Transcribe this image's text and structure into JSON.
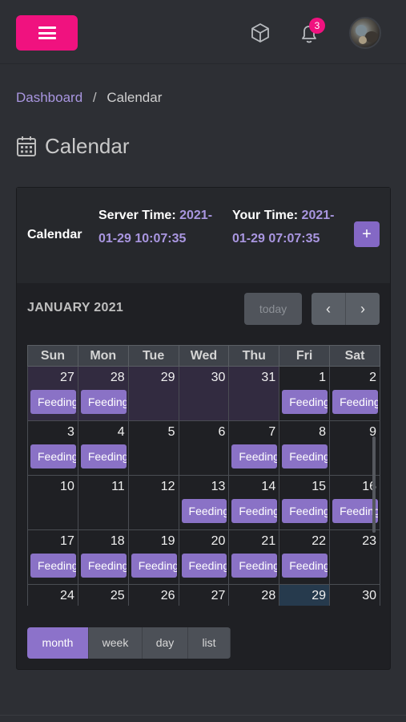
{
  "header": {
    "menu_icon": "hamburger-icon",
    "cube_icon": "cube-icon",
    "bell_icon": "bell-icon",
    "notification_count": "3",
    "avatar": "user-avatar"
  },
  "breadcrumb": {
    "home": "Dashboard",
    "separator": "/",
    "current": "Calendar"
  },
  "page": {
    "title": "Calendar",
    "icon": "calendar-icon"
  },
  "card": {
    "title": "Calendar",
    "server_label": "Server Time:",
    "server_time": "2021-01-29 10:07:35",
    "your_label": "Your Time:",
    "your_time": "2021-01-29 07:07:35",
    "add_label": "+"
  },
  "toolbar": {
    "month_title": "JANUARY 2021",
    "today_label": "today",
    "prev_icon": "chevron-left-icon",
    "next_icon": "chevron-right-icon",
    "prev_glyph": "‹",
    "next_glyph": "›"
  },
  "weekdays": [
    "Sun",
    "Mon",
    "Tue",
    "Wed",
    "Thu",
    "Fri",
    "Sat"
  ],
  "weeks": [
    [
      {
        "d": "27",
        "o": true,
        "e": "Feeding"
      },
      {
        "d": "28",
        "o": true,
        "e": "Feeding"
      },
      {
        "d": "29",
        "o": true,
        "e": ""
      },
      {
        "d": "30",
        "o": true,
        "e": ""
      },
      {
        "d": "31",
        "o": true,
        "e": ""
      },
      {
        "d": "1",
        "o": false,
        "e": "Feeding"
      },
      {
        "d": "2",
        "o": false,
        "e": "Feeding"
      }
    ],
    [
      {
        "d": "3",
        "o": false,
        "e": "Feeding"
      },
      {
        "d": "4",
        "o": false,
        "e": "Feeding"
      },
      {
        "d": "5",
        "o": false,
        "e": ""
      },
      {
        "d": "6",
        "o": false,
        "e": ""
      },
      {
        "d": "7",
        "o": false,
        "e": "Feeding"
      },
      {
        "d": "8",
        "o": false,
        "e": "Feeding"
      },
      {
        "d": "9",
        "o": false,
        "e": ""
      }
    ],
    [
      {
        "d": "10",
        "o": false,
        "e": ""
      },
      {
        "d": "11",
        "o": false,
        "e": ""
      },
      {
        "d": "12",
        "o": false,
        "e": ""
      },
      {
        "d": "13",
        "o": false,
        "e": "Feeding"
      },
      {
        "d": "14",
        "o": false,
        "e": "Feeding"
      },
      {
        "d": "15",
        "o": false,
        "e": "Feeding"
      },
      {
        "d": "16",
        "o": false,
        "e": "Feeding"
      }
    ],
    [
      {
        "d": "17",
        "o": false,
        "e": "Feeding"
      },
      {
        "d": "18",
        "o": false,
        "e": "Feeding"
      },
      {
        "d": "19",
        "o": false,
        "e": "Feeding"
      },
      {
        "d": "20",
        "o": false,
        "e": "Feeding"
      },
      {
        "d": "21",
        "o": false,
        "e": "Feeding"
      },
      {
        "d": "22",
        "o": false,
        "e": "Feeding"
      },
      {
        "d": "23",
        "o": false,
        "e": ""
      }
    ],
    [
      {
        "d": "24",
        "o": false,
        "e": ""
      },
      {
        "d": "25",
        "o": false,
        "e": ""
      },
      {
        "d": "26",
        "o": false,
        "e": ""
      },
      {
        "d": "27",
        "o": false,
        "e": ""
      },
      {
        "d": "28",
        "o": false,
        "e": ""
      },
      {
        "d": "29",
        "o": false,
        "e": "",
        "t": true
      },
      {
        "d": "30",
        "o": false,
        "e": ""
      }
    ]
  ],
  "views": [
    "month",
    "week",
    "day",
    "list"
  ],
  "active_view": "month",
  "colors": {
    "accent": "#f0127f",
    "purple": "#8a72c6",
    "link": "#a996e0",
    "today_bg": "#263a4d"
  }
}
